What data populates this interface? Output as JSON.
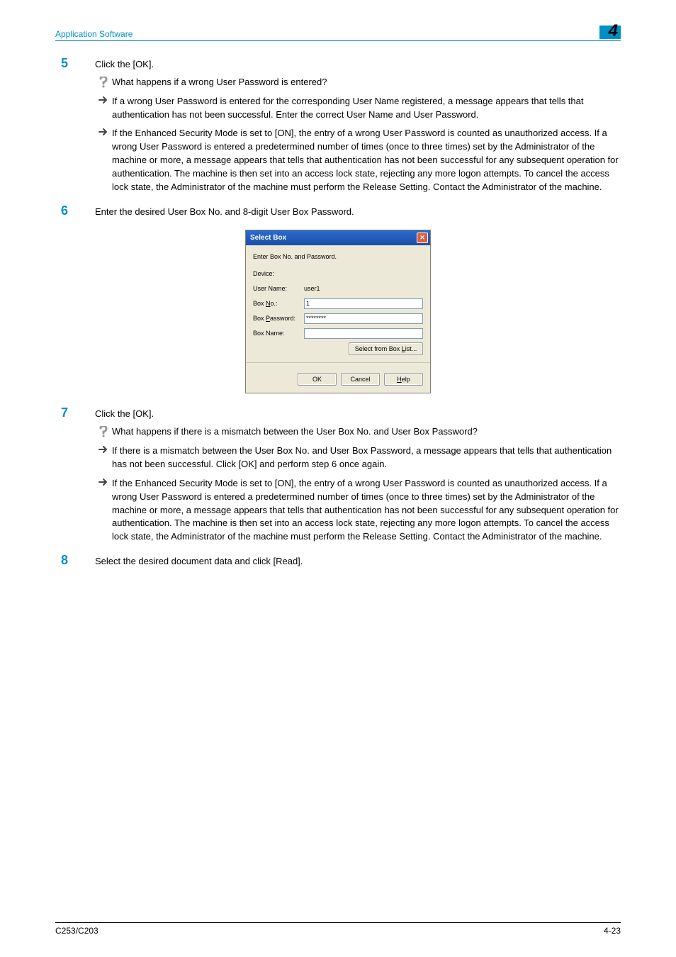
{
  "header": {
    "section": "Application Software",
    "chapter": "4"
  },
  "steps": {
    "s5": {
      "num": "5",
      "text": "Click the [OK].",
      "q": "What happens if a wrong User Password is entered?",
      "a1": "If a wrong User Password is entered for the corresponding User Name registered, a message appears that tells that authentication has not been successful. Enter the correct User Name and User Password.",
      "a2": "If the Enhanced Security Mode is set to [ON], the entry of a wrong User Password is counted as unauthorized access. If a wrong User Password is entered a predetermined number of times (once to three times) set by the Administrator of the machine or more, a message appears that tells that authentication has not been successful for any subsequent operation for authentication. The machine is then set into an access lock state, rejecting any more logon attempts. To cancel the access lock state, the Administrator of the machine must perform the Release Setting. Contact the Administrator of the machine."
    },
    "s6": {
      "num": "6",
      "text": "Enter the desired User Box No. and 8-digit User Box Password."
    },
    "s7": {
      "num": "7",
      "text": "Click the [OK].",
      "q": "What happens if there is a mismatch between the User Box No. and User Box Password?",
      "a1": "If there is a mismatch between the User Box No. and User Box Password, a message appears that tells that authentication has not been successful. Click [OK] and perform step 6 once again.",
      "a2": "If the Enhanced Security Mode is set to [ON], the entry of a wrong User Password is counted as unauthorized access. If a wrong User Password is entered a predetermined number of times (once to three times) set by the Administrator of the machine or more, a message appears that tells that authentication has not been successful for any subsequent operation for authentication. The machine is then set into an access lock state, rejecting any more logon attempts. To cancel the access lock state, the Administrator of the machine must perform the Release Setting. Contact the Administrator of the machine."
    },
    "s8": {
      "num": "8",
      "text": "Select the desired document data and click [Read]."
    }
  },
  "dialog": {
    "title": "Select Box",
    "intro": "Enter Box No. and Password.",
    "labels": {
      "device": "Device:",
      "user_name": "User Name:",
      "box_no_pre": "Box ",
      "box_no_u": "N",
      "box_no_post": "o.:",
      "box_pw_pre": "Box ",
      "box_pw_u": "P",
      "box_pw_post": "assword:",
      "box_name": "Box Name:"
    },
    "values": {
      "user_name": "user1",
      "box_no": "1",
      "box_password": "********"
    },
    "buttons": {
      "select_pre": "Select from Box ",
      "select_u": "L",
      "select_post": "ist...",
      "ok": "OK",
      "cancel": "Cancel",
      "help_u": "H",
      "help_post": "elp"
    }
  },
  "footer": {
    "left": "C253/C203",
    "right": "4-23"
  }
}
